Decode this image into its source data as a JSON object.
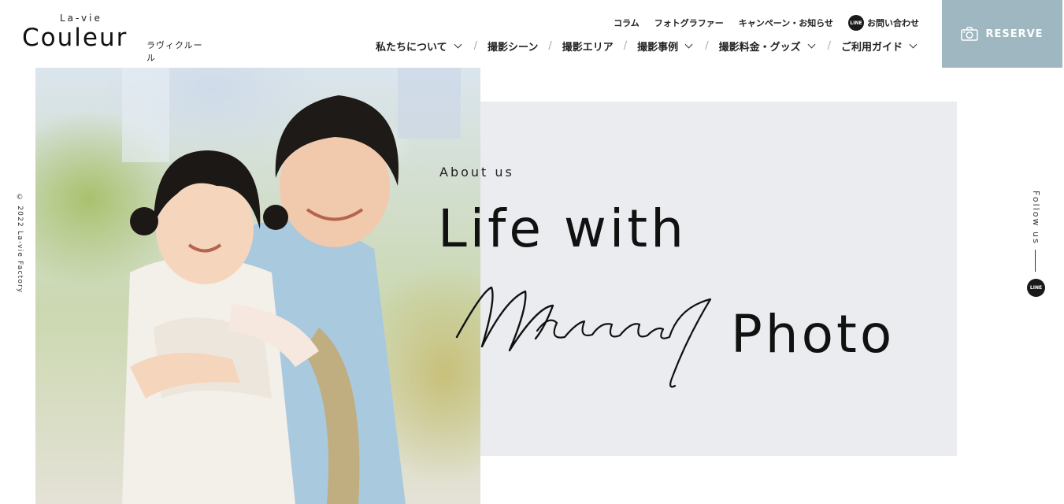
{
  "brand": {
    "top": "La-vie",
    "name": "Couleur",
    "kana": "ラヴィクルール"
  },
  "header": {
    "subnav": [
      {
        "label": "コラム"
      },
      {
        "label": "フォトグラファー"
      },
      {
        "label": "キャンペーン・お知らせ"
      },
      {
        "label": "お問い合わせ",
        "icon": "line-icon",
        "icon_text": "LINE"
      }
    ],
    "mainnav": [
      {
        "label": "私たちについて",
        "dropdown": true
      },
      {
        "label": "撮影シーン",
        "dropdown": false
      },
      {
        "label": "撮影エリア",
        "dropdown": false
      },
      {
        "label": "撮影事例",
        "dropdown": true
      },
      {
        "label": "撮影料金・グッズ",
        "dropdown": true
      },
      {
        "label": "ご利用ガイド",
        "dropdown": true
      }
    ],
    "separator": "/",
    "reserve": {
      "label": "RESERVE",
      "icon": "camera-icon",
      "color": "#9fb7c1"
    }
  },
  "hero": {
    "eyebrow": "About us",
    "line1": "Life with",
    "script_word": "Memorial",
    "line2_end": "Photo",
    "panel_color": "#ebecef",
    "image": "children-kimono-photo"
  },
  "side": {
    "copyright": "© 2022 La-vie Factory",
    "follow": "Follow us",
    "line_icon_text": "LINE"
  }
}
